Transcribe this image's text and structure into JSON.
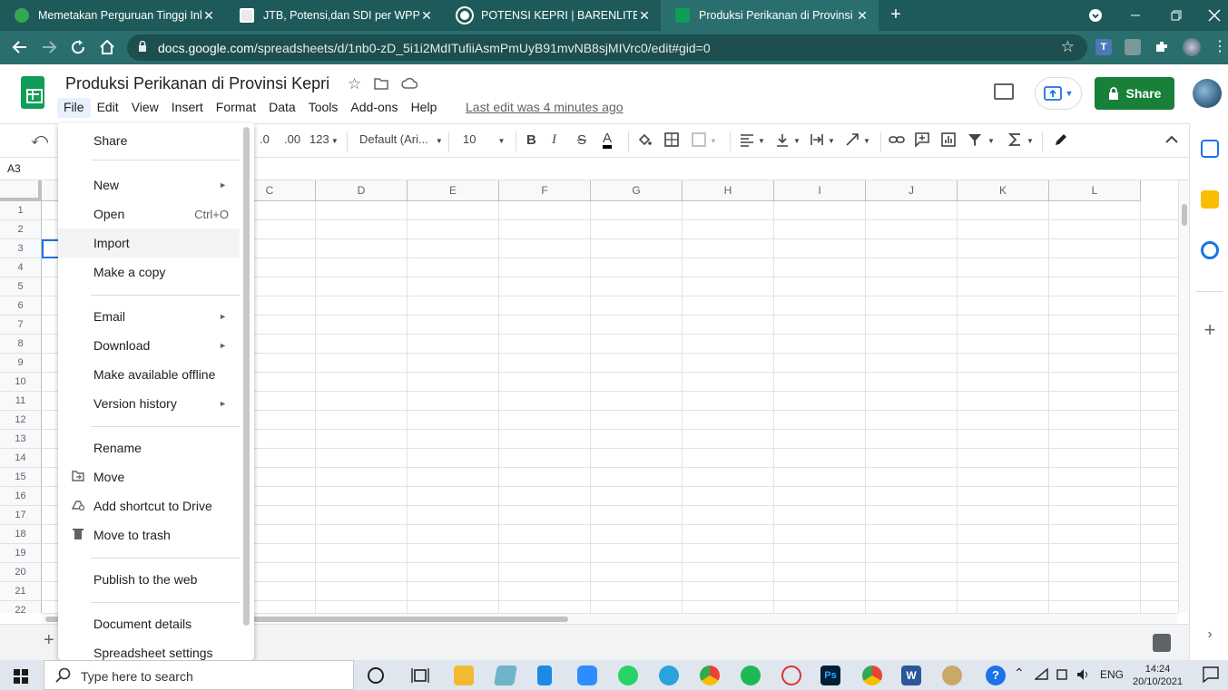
{
  "browser": {
    "tabs": [
      {
        "title": "Memetakan Perguruan Tinggi Inklusif",
        "color": "#34a853"
      },
      {
        "title": "JTB, Potensi,dan SDI per WPP",
        "color": "#e8eaed"
      },
      {
        "title": "POTENSI KEPRI | BARENLITBANG",
        "color": "#ffffff"
      },
      {
        "title": "Produksi Perikanan di Provinsi Kepri",
        "color": "#0f9d58"
      }
    ],
    "close_glyph": "✕",
    "new_tab_glyph": "+",
    "url_host": "docs.google.com",
    "url_path": "/spreadsheets/d/1nb0-zD_5i1i2MdITufiiAsmPmUyB91mvNB8sjMIVrc0/edit#gid=0"
  },
  "sheets": {
    "title": "Produksi Perikanan di Provinsi Kepri",
    "menu": [
      "File",
      "Edit",
      "View",
      "Insert",
      "Format",
      "Data",
      "Tools",
      "Add-ons",
      "Help"
    ],
    "last_edit": "Last edit was 4 minutes ago",
    "share_label": "Share",
    "toolbar": {
      "decimal_less": ".0",
      "decimal_more": ".00",
      "number_format": "123",
      "font": "Default (Ari...",
      "font_size": "10",
      "bold": "B",
      "italic": "I",
      "strike": "S",
      "text_color": "A"
    },
    "name_box": "A3",
    "columns": [
      "C",
      "D",
      "E",
      "F",
      "G",
      "H",
      "I",
      "J",
      "K",
      "L"
    ],
    "rows": [
      "1",
      "2",
      "3",
      "4",
      "5",
      "6",
      "7",
      "8",
      "9",
      "10",
      "11",
      "12",
      "13",
      "14",
      "15",
      "16",
      "17",
      "18",
      "19",
      "20",
      "21",
      "22"
    ],
    "add_sheet": "+"
  },
  "file_menu": {
    "items": [
      {
        "label": "Share"
      },
      {
        "label": "New",
        "arrow": "►"
      },
      {
        "label": "Open",
        "shortcut": "Ctrl+O"
      },
      {
        "label": "Import"
      },
      {
        "label": "Make a copy"
      },
      {
        "label": "Email",
        "arrow": "►"
      },
      {
        "label": "Download",
        "arrow": "►"
      },
      {
        "label": "Make available offline"
      },
      {
        "label": "Version history",
        "arrow": "►"
      },
      {
        "label": "Rename"
      },
      {
        "label": "Move"
      },
      {
        "label": "Add shortcut to Drive"
      },
      {
        "label": "Move to trash"
      },
      {
        "label": "Publish to the web"
      },
      {
        "label": "Document details"
      },
      {
        "label": "Spreadsheet settings"
      }
    ]
  },
  "taskbar": {
    "search_placeholder": "Type here to search",
    "lang": "ENG",
    "time": "14:24",
    "date": "20/10/2021"
  },
  "colors": {
    "chrome_frame": "#1f5a5a",
    "sheets_green": "#0f9d58",
    "share_green": "#188038",
    "selection_blue": "#1a73e8"
  }
}
